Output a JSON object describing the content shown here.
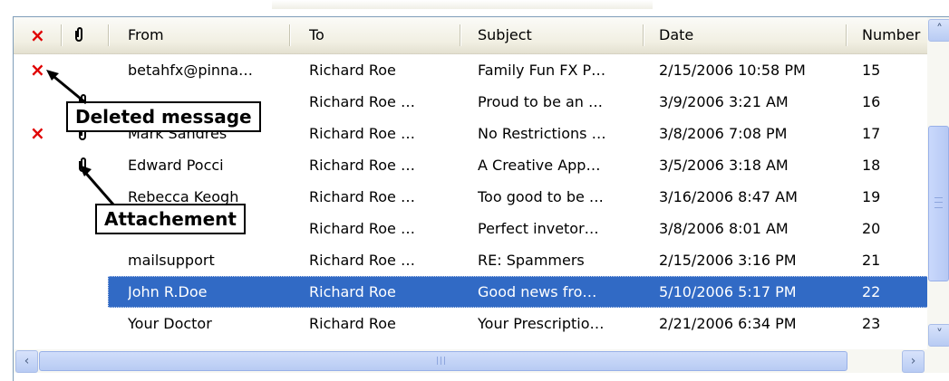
{
  "columns": {
    "deleted_icon": "×",
    "attachment_icon": "🖇",
    "from": "From",
    "to": "To",
    "subject": "Subject",
    "date": "Date",
    "number": "Number"
  },
  "rows": [
    {
      "deleted": true,
      "attachment": false,
      "from": "betahfx@pinna…",
      "to": "Richard Roe",
      "subject": "Family Fun FX P…",
      "date": "2/15/2006 10:58 PM",
      "number": "15"
    },
    {
      "deleted": false,
      "attachment": true,
      "from": "",
      "to": "Richard Roe  …",
      "subject": "Proud to be an …",
      "date": "3/9/2006 3:21 AM",
      "number": "16"
    },
    {
      "deleted": true,
      "attachment": true,
      "from": "Mark Sandres",
      "to": "Richard Roe  …",
      "subject": "No Restrictions …",
      "date": "3/8/2006 7:08 PM",
      "number": "17"
    },
    {
      "deleted": false,
      "attachment": true,
      "from": "Edward Pocci",
      "to": "Richard Roe  …",
      "subject": "A Creative App…",
      "date": "3/5/2006 3:18 AM",
      "number": "18"
    },
    {
      "deleted": false,
      "attachment": false,
      "from": "Rebecca Keogh",
      "to": "Richard Roe  …",
      "subject": "Too good to be …",
      "date": "3/16/2006 8:47 AM",
      "number": "19"
    },
    {
      "deleted": false,
      "attachment": false,
      "from": "",
      "to": "Richard Roe  …",
      "subject": "Perfect invetor…",
      "date": "3/8/2006 8:01 AM",
      "number": "20"
    },
    {
      "deleted": false,
      "attachment": false,
      "from": "mailsupport",
      "to": "Richard Roe  …",
      "subject": "RE: Spammers",
      "date": "2/15/2006 3:16 PM",
      "number": "21"
    },
    {
      "deleted": false,
      "attachment": false,
      "from": "John R.Doe",
      "to": "Richard Roe",
      "subject": "Good news fro…",
      "date": "5/10/2006 5:17 PM",
      "number": "22",
      "selected": true
    },
    {
      "deleted": false,
      "attachment": false,
      "from": "Your Doctor",
      "to": "Richard Roe",
      "subject": "Your Prescriptio…",
      "date": "2/21/2006 6:34 PM",
      "number": "23"
    }
  ],
  "callouts": {
    "deleted": "Deleted message",
    "attachment": "Attachement"
  },
  "scrollbars": {
    "up_icon": "chevron-up-icon",
    "down_icon": "chevron-down-icon",
    "left_icon": "chevron-left-icon",
    "right_icon": "chevron-right-icon"
  },
  "colors": {
    "selection": "#316ac5",
    "deleted_icon": "#e00000",
    "scrollbar": "#c1d3fb"
  }
}
